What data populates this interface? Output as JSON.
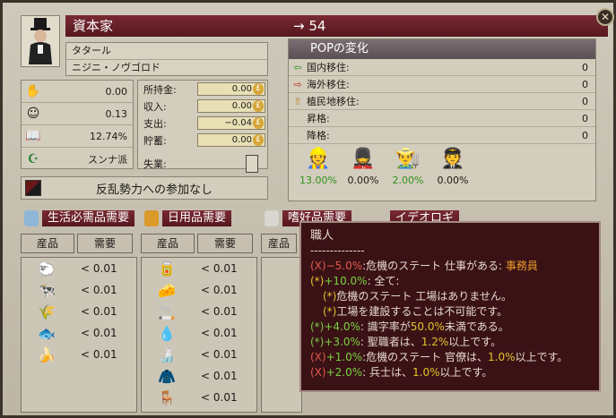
{
  "header": {
    "title": "資本家",
    "arrow": "→",
    "size": "54",
    "close": "✕"
  },
  "culture": {
    "culture": "タタール",
    "location": "ニジニ・ノヴゴロド"
  },
  "stats": [
    {
      "icon": "militancy-icon",
      "glyph": "✋",
      "value": "0.00"
    },
    {
      "icon": "consciousness-icon",
      "glyph": "☺",
      "value": "0.13"
    },
    {
      "icon": "literacy-icon",
      "glyph": "📖",
      "value": "12.74%"
    },
    {
      "icon": "religion-icon",
      "glyph": "☪",
      "value": "スンナ派"
    }
  ],
  "money": {
    "rows": [
      {
        "label": "所持金:",
        "value": "0.00"
      },
      {
        "label": "収入:",
        "value": "0.00"
      },
      {
        "label": "支出:",
        "value": "−0.04"
      },
      {
        "label": "貯蓄:",
        "value": "0.00"
      }
    ],
    "unemployment_label": "失業:"
  },
  "rebel": {
    "label": "反乱勢力への参加なし"
  },
  "pop_change": {
    "title": "POPの変化",
    "rows": [
      {
        "icon": "internal-migration-icon",
        "glyph": "⇦",
        "label": "国内移住:",
        "value": "0"
      },
      {
        "icon": "emigration-icon",
        "glyph": "⇨",
        "label": "海外移住:",
        "value": "0"
      },
      {
        "icon": "colonial-migration-icon",
        "glyph": "⇧",
        "label": "植民地移住:",
        "value": "0"
      },
      {
        "icon": "",
        "glyph": "",
        "label": "昇格:",
        "value": "0"
      },
      {
        "icon": "",
        "glyph": "",
        "label": "降格:",
        "value": "0"
      }
    ],
    "figures": [
      {
        "name": "pop-figure-1",
        "pct": "13.00%",
        "color": "#2f8f1a"
      },
      {
        "name": "pop-figure-2",
        "pct": "0.00%",
        "color": "#1c1a16"
      },
      {
        "name": "pop-figure-3",
        "pct": "2.00%",
        "color": "#2f8f1a"
      },
      {
        "name": "pop-figure-4",
        "pct": "0.00%",
        "color": "#1c1a16"
      }
    ]
  },
  "needs": {
    "life": "生活必需品需要",
    "everyday": "日用品需要",
    "luxury": "嗜好品需要",
    "fourth": "イデオロギ"
  },
  "columns": {
    "header_product": "産品",
    "header_demand": "需要",
    "life_goods": [
      "0.01",
      "0.01",
      "0.01",
      "0.01",
      "0.01"
    ],
    "everyday_goods": [
      "0.01",
      "0.01",
      "0.01",
      "0.01",
      "0.01",
      "0.01",
      "0.01"
    ],
    "demand_prefix": "< "
  },
  "tooltip": {
    "title": "職人",
    "separator": "--------------",
    "lines": [
      {
        "mark": "(X)",
        "mark_class": "red",
        "value": "−5.0%",
        "value_class": "red",
        "text": ":危機のステート 仕事がある: ",
        "extra": "事務員",
        "extra_class": "org",
        "tail": ""
      },
      {
        "mark": "(*)",
        "mark_class": "ylw",
        "value": "+10.0%",
        "value_class": "grn",
        "text": ": 全て:",
        "extra": "",
        "extra_class": "",
        "tail": ""
      },
      {
        "mark": "(*)",
        "mark_class": "ylw",
        "value": "",
        "value_class": "",
        "text": "危機のステート 工場はありません。",
        "extra": "",
        "extra_class": "",
        "tail": "",
        "indent": true
      },
      {
        "mark": "(*)",
        "mark_class": "ylw",
        "value": "",
        "value_class": "",
        "text": "工場を建設することは不可能です。",
        "extra": "",
        "extra_class": "",
        "tail": "",
        "indent": true
      },
      {
        "mark": "(*)",
        "mark_class": "grn",
        "value": "+4.0%",
        "value_class": "grn",
        "text": ": 識字率が",
        "extra": "50.0%",
        "extra_class": "ylw",
        "tail": "未満である。"
      },
      {
        "mark": "(*)",
        "mark_class": "grn",
        "value": "+3.0%",
        "value_class": "grn",
        "text": ": 聖職者は、",
        "extra": "1.2%",
        "extra_class": "ylw",
        "tail": "以上です。"
      },
      {
        "mark": "(X)",
        "mark_class": "red",
        "value": "+1.0%",
        "value_class": "grn",
        "text": ":危機のステート 官僚は、",
        "extra": "1.0%",
        "extra_class": "ylw",
        "tail": "以上です。"
      },
      {
        "mark": "(X)",
        "mark_class": "red",
        "value": "+2.0%",
        "value_class": "grn",
        "text": ": 兵士は、",
        "extra": "1.0%",
        "extra_class": "ylw",
        "tail": "以上です。"
      }
    ]
  }
}
